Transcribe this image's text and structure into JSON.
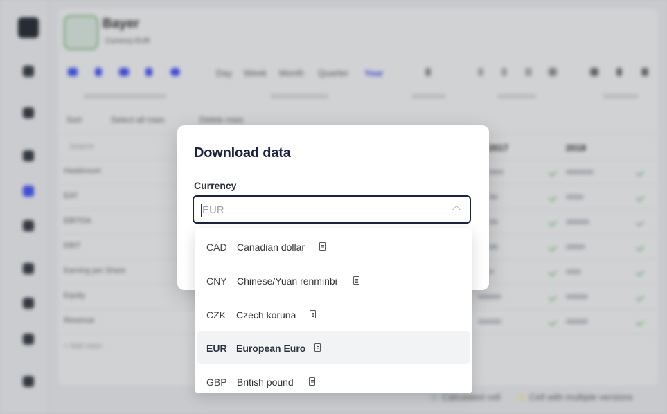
{
  "app": {
    "company_name": "Bayer",
    "company_subtitle": "Currency EUR"
  },
  "toolbar": {
    "periods": [
      "Day",
      "Week",
      "Month",
      "Quarter",
      "Year"
    ],
    "active_period": "Year",
    "accent_color": "#4a5bff"
  },
  "table": {
    "toolbar_items": [
      "Sort",
      "Select all rows",
      "Delete rows"
    ],
    "search_placeholder": "Search",
    "column_headers": [
      "2017",
      "2018"
    ],
    "rows": [
      "Headcount",
      "EAT",
      "EBITDA",
      "EBIT",
      "Earning per Share",
      "Equity",
      "Revenue"
    ],
    "add_rows_label": "+ Add rows"
  },
  "legend": {
    "calculated": "Calculated cell",
    "multiple_versions": "Cell with multiple versions"
  },
  "modal": {
    "title": "Download data",
    "currency_label": "Currency",
    "currency_value": "EUR",
    "options": [
      {
        "code": "CAD",
        "name": "Canadian dollar",
        "icon": "document-icon"
      },
      {
        "code": "CNY",
        "name": "Chinese/Yuan renminbi",
        "icon": "document-icon"
      },
      {
        "code": "CZK",
        "name": "Czech koruna",
        "icon": "document-icon"
      },
      {
        "code": "EUR",
        "name": "European Euro",
        "icon": "document-icon",
        "selected": true
      },
      {
        "code": "GBP",
        "name": "British pound",
        "icon": "document-icon"
      }
    ]
  }
}
